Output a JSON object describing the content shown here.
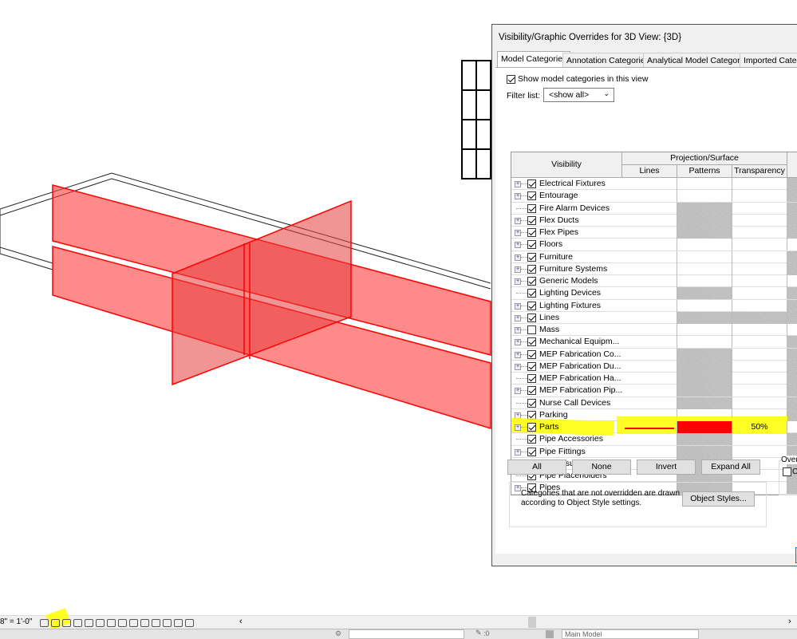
{
  "dialog": {
    "title": "Visibility/Graphic Overrides for 3D View: {3D}",
    "tabs": [
      "Model Categories",
      "Annotation Categories",
      "Analytical Model Categories",
      "Imported Catego"
    ],
    "show_categories_label": "Show model categories in this view",
    "show_categories_checked": true,
    "filter_label": "Filter list:",
    "filter_value": "<show all>",
    "columns": {
      "visibility": "Visibility",
      "group": "Projection/Surface",
      "lines": "Lines",
      "patterns": "Patterns",
      "transparency": "Transparency"
    },
    "rows": [
      {
        "name": "Electrical Fixtures",
        "expand": true,
        "checked": true,
        "pat_grey": false,
        "last_grey": true
      },
      {
        "name": "Entourage",
        "expand": true,
        "checked": true,
        "pat_grey": false,
        "last_grey": true
      },
      {
        "name": "Fire Alarm Devices",
        "expand": false,
        "checked": true,
        "pat_grey": true,
        "last_grey": true
      },
      {
        "name": "Flex Ducts",
        "expand": true,
        "checked": true,
        "pat_grey": true,
        "last_grey": true
      },
      {
        "name": "Flex Pipes",
        "expand": true,
        "checked": true,
        "pat_grey": true,
        "last_grey": true
      },
      {
        "name": "Floors",
        "expand": true,
        "checked": true,
        "pat_grey": false,
        "last_grey": false
      },
      {
        "name": "Furniture",
        "expand": true,
        "checked": true,
        "pat_grey": false,
        "last_grey": true
      },
      {
        "name": "Furniture Systems",
        "expand": true,
        "checked": true,
        "pat_grey": false,
        "last_grey": true
      },
      {
        "name": "Generic Models",
        "expand": true,
        "checked": true,
        "pat_grey": false,
        "last_grey": false
      },
      {
        "name": "Lighting Devices",
        "expand": false,
        "checked": true,
        "pat_grey": true,
        "last_grey": true
      },
      {
        "name": "Lighting Fixtures",
        "expand": true,
        "checked": true,
        "pat_grey": false,
        "last_grey": true
      },
      {
        "name": "Lines",
        "expand": true,
        "checked": true,
        "pat_grey": true,
        "trans_grey": true,
        "last_grey": true
      },
      {
        "name": "Mass",
        "expand": true,
        "checked": false,
        "pat_grey": false,
        "last_grey": false
      },
      {
        "name": "Mechanical Equipm...",
        "expand": true,
        "checked": true,
        "pat_grey": false,
        "last_grey": true
      },
      {
        "name": "MEP Fabrication Co...",
        "expand": true,
        "checked": true,
        "pat_grey": true,
        "last_grey": true
      },
      {
        "name": "MEP Fabrication Du...",
        "expand": true,
        "checked": true,
        "pat_grey": true,
        "last_grey": true
      },
      {
        "name": "MEP Fabrication Ha...",
        "expand": false,
        "checked": true,
        "pat_grey": true,
        "last_grey": true
      },
      {
        "name": "MEP Fabrication Pip...",
        "expand": true,
        "checked": true,
        "pat_grey": true,
        "last_grey": true
      },
      {
        "name": "Nurse Call Devices",
        "expand": false,
        "checked": true,
        "pat_grey": true,
        "last_grey": true
      },
      {
        "name": "Parking",
        "expand": true,
        "checked": true,
        "pat_grey": false,
        "last_grey": true
      },
      {
        "name": "Parts",
        "expand": true,
        "checked": true,
        "pat_grey": false,
        "last_grey": false,
        "highlight": true,
        "line_color": "#ff0000",
        "pattern_color": "#ff0000",
        "transparency": "50%"
      },
      {
        "name": "Pipe Accessories",
        "expand": false,
        "checked": true,
        "pat_grey": true,
        "last_grey": true
      },
      {
        "name": "Pipe Fittings",
        "expand": true,
        "checked": true,
        "pat_grey": true,
        "last_grey": true
      },
      {
        "name": "Pipe Insulations",
        "expand": false,
        "checked": true,
        "pat_grey": true,
        "last_grey": true
      },
      {
        "name": "Pipe Placeholders",
        "expand": false,
        "checked": true,
        "pat_grey": true,
        "last_grey": true
      },
      {
        "name": "Pipes",
        "expand": true,
        "checked": true,
        "pat_grey": true,
        "last_grey": true
      }
    ],
    "buttons": {
      "all": "All",
      "none": "None",
      "invert": "Invert",
      "expand_all": "Expand All",
      "object_styles": "Object Styles..."
    },
    "info_text_1": "Categories that are not overridden are drawn",
    "info_text_2": "according to Object Style settings.",
    "override_group": "Overr",
    "override_check": "C"
  },
  "statusbar": {
    "scale": "8\" = 1'-0\""
  },
  "bottombar": {
    "workset_value": ":0",
    "model_value": "Main Model"
  },
  "colors": {
    "part_red": "#ff0000",
    "highlight": "#ffff00"
  }
}
